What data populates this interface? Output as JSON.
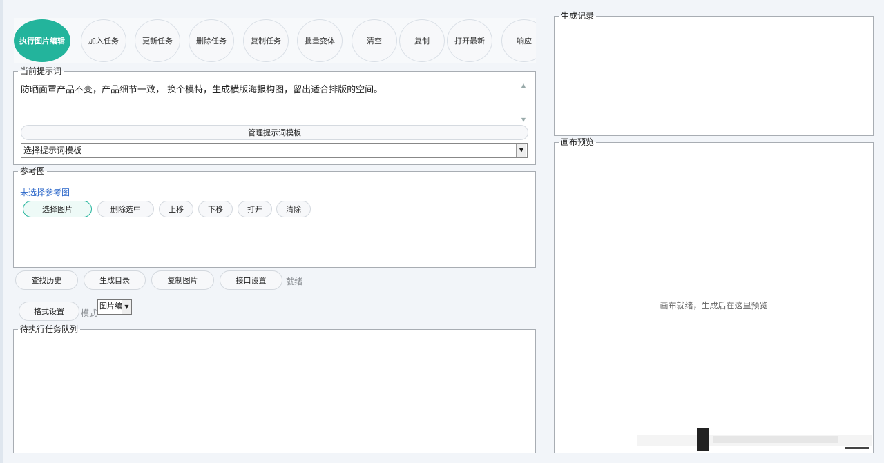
{
  "toolbar": {
    "buttons": [
      {
        "label": "执行图片编辑",
        "primary": true
      },
      {
        "label": "加入任务"
      },
      {
        "label": "更新任务"
      },
      {
        "label": "删除任务"
      },
      {
        "label": "复制任务"
      },
      {
        "label": "批量变体"
      },
      {
        "label": "清空"
      },
      {
        "label": "复制"
      },
      {
        "label": "打开最新"
      },
      {
        "label": "响应"
      }
    ]
  },
  "prompt_panel": {
    "legend": "当前提示词",
    "text": "防晒面罩产品不变，产品细节一致， 换个模特，生成横版海报构图，留出适合排版的空间。",
    "manage_button": "管理提示词模板",
    "template_select": "选择提示词模板"
  },
  "reference_panel": {
    "legend": "参考图",
    "status": "未选择参考图",
    "buttons": [
      "选择图片",
      "删除选中",
      "上移",
      "下移",
      "打开",
      "清除"
    ]
  },
  "action_row": {
    "buttons": [
      "查找历史",
      "生成目录",
      "复制图片",
      "接口设置"
    ],
    "status": "就绪"
  },
  "format_row": {
    "format_button": "格式设置",
    "mode_label": "模式",
    "mode_value": "图片编"
  },
  "queue_panel": {
    "legend": "待执行任务队列"
  },
  "history_panel": {
    "legend": "生成记录"
  },
  "preview_panel": {
    "legend": "画布预览",
    "placeholder": "画布就绪，生成后在这里预览"
  },
  "colors": {
    "accent": "#23b49c",
    "link": "#2a66c9"
  }
}
